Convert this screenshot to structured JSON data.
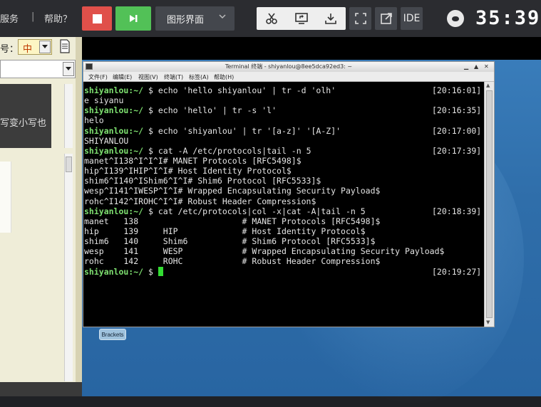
{
  "topbar": {
    "menu_service": "服务",
    "separator": "|",
    "menu_help": "帮助？",
    "gui_label": "图形界面",
    "ide_label": "IDE",
    "timer": "35:39"
  },
  "left_panel": {
    "size_label": "号：",
    "size_value": "中",
    "dark_text": "写变小写也"
  },
  "desktop": {
    "brackets_label": "Brackets"
  },
  "terminal": {
    "title": "Terminal 终端 - shiyanlou@8ee5dca92ed3: ~",
    "menu": [
      "文件(F)",
      "编辑(E)",
      "视图(V)",
      "终端(T)",
      "标签(A)",
      "帮助(H)"
    ],
    "lines": [
      {
        "prompt": "shiyanlou:~/",
        "text": " $ echo 'hello shiyanlou' | tr -d 'olh'",
        "ts": "[20:16:01]"
      },
      {
        "prompt": "",
        "text": "e siyanu",
        "ts": ""
      },
      {
        "prompt": "shiyanlou:~/",
        "text": " $ echo 'hello' | tr -s 'l'",
        "ts": "[20:16:35]"
      },
      {
        "prompt": "",
        "text": "helo",
        "ts": ""
      },
      {
        "prompt": "shiyanlou:~/",
        "text": " $ echo 'shiyanlou' | tr '[a-z]' '[A-Z]'",
        "ts": "[20:17:00]"
      },
      {
        "prompt": "",
        "text": "SHIYANLOU",
        "ts": ""
      },
      {
        "prompt": "shiyanlou:~/",
        "text": " $ cat -A /etc/protocols|tail -n 5",
        "ts": "[20:17:39]"
      },
      {
        "prompt": "",
        "text": "manet^I138^I^I^I# MANET Protocols [RFC5498]$",
        "ts": ""
      },
      {
        "prompt": "",
        "text": "hip^I139^IHIP^I^I# Host Identity Protocol$",
        "ts": ""
      },
      {
        "prompt": "",
        "text": "shim6^I140^IShim6^I^I# Shim6 Protocol [RFC5533]$",
        "ts": ""
      },
      {
        "prompt": "",
        "text": "wesp^I141^IWESP^I^I# Wrapped Encapsulating Security Payload$",
        "ts": ""
      },
      {
        "prompt": "",
        "text": "rohc^I142^IROHC^I^I# Robust Header Compression$",
        "ts": ""
      },
      {
        "prompt": "shiyanlou:~/",
        "text": " $ cat /etc/protocols|col -x|cat -A|tail -n 5",
        "ts": "[20:18:39]"
      },
      {
        "prompt": "",
        "text": "manet   138                     # MANET Protocols [RFC5498]$",
        "ts": ""
      },
      {
        "prompt": "",
        "text": "hip     139     HIP             # Host Identity Protocol$",
        "ts": ""
      },
      {
        "prompt": "",
        "text": "shim6   140     Shim6           # Shim6 Protocol [RFC5533]$",
        "ts": ""
      },
      {
        "prompt": "",
        "text": "wesp    141     WESP            # Wrapped Encapsulating Security Payload$",
        "ts": ""
      },
      {
        "prompt": "",
        "text": "rohc    142     ROHC            # Robust Header Compression$",
        "ts": ""
      },
      {
        "prompt": "shiyanlou:~/",
        "text": " $ ",
        "ts": "[20:19:27]",
        "cursor": true
      }
    ]
  }
}
